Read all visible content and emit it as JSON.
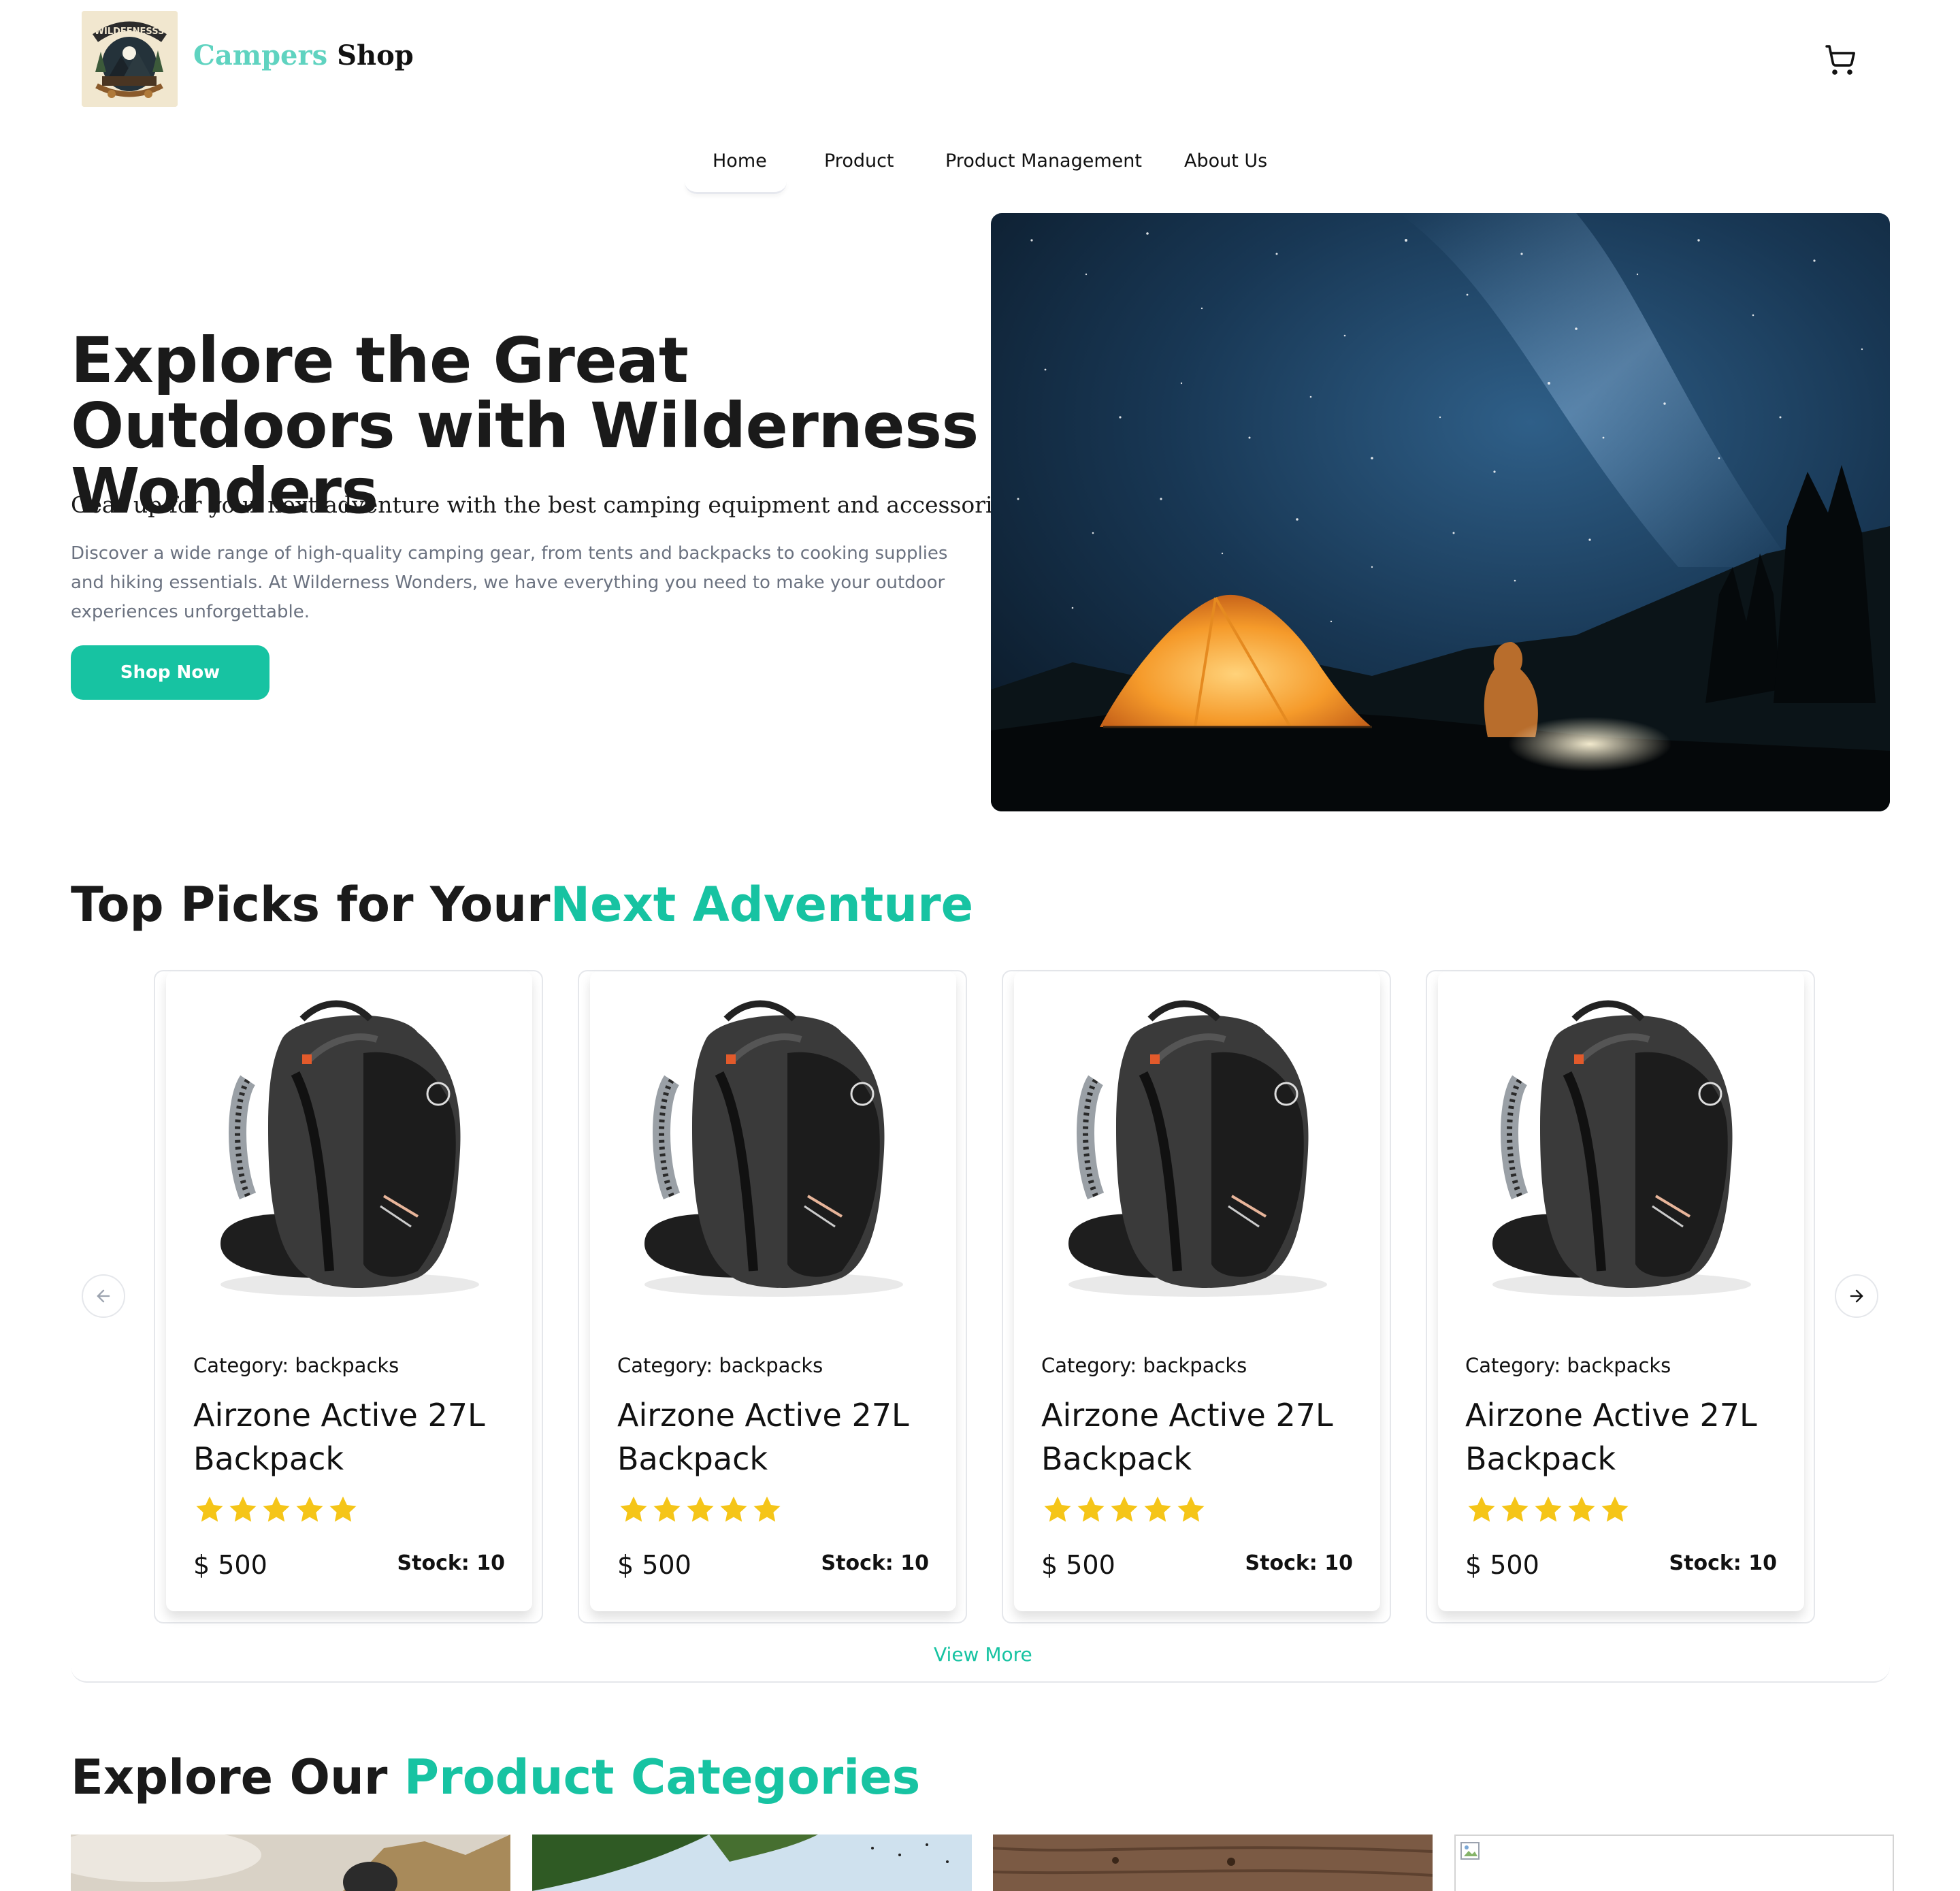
{
  "header": {
    "logo_text": "WILDEENESSS",
    "brand_part1": "Campers",
    "brand_part2": "Shop"
  },
  "nav": {
    "items": [
      {
        "label": "Home"
      },
      {
        "label": "Product"
      },
      {
        "label": "Product Management"
      },
      {
        "label": "About Us"
      }
    ],
    "active": "Home"
  },
  "hero": {
    "title": "Explore the Great Outdoors with Wilderness Wonders",
    "subtitle": "Gear up for your next adventure with the best camping equipment and accessories.",
    "description": "Discover a wide range of high-quality camping gear, from tents and backpacks to cooking supplies and hiking essentials. At Wilderness Wonders, we have everything you need to make your outdoor experiences unforgettable.",
    "cta_label": "Shop Now"
  },
  "top_picks": {
    "title_part1": "Top Picks for Your",
    "title_part2": "Next Adventure",
    "products": [
      {
        "category": "Category: backpacks",
        "name": "Airzone Active 27L Backpack",
        "rating": 5,
        "price": "$ 500",
        "stock": "Stock: 10"
      },
      {
        "category": "Category: backpacks",
        "name": "Airzone Active 27L Backpack",
        "rating": 5,
        "price": "$ 500",
        "stock": "Stock: 10"
      },
      {
        "category": "Category: backpacks",
        "name": "Airzone Active 27L Backpack",
        "rating": 5,
        "price": "$ 500",
        "stock": "Stock: 10"
      },
      {
        "category": "Category: backpacks",
        "name": "Airzone Active 27L Backpack",
        "rating": 5,
        "price": "$ 500",
        "stock": "Stock: 10"
      }
    ],
    "view_more_label": "View More"
  },
  "categories": {
    "title_part1": "Explore Our",
    "title_part2": "Product Categories"
  },
  "colors": {
    "accent": "#17c3a2",
    "brand_light": "#5fd3c0",
    "star": "#f5c518",
    "muted_text": "#6b7280"
  },
  "icons": {
    "cart": "shopping-cart-icon",
    "prev": "arrow-left-icon",
    "next": "arrow-right-icon",
    "star": "star-icon"
  }
}
